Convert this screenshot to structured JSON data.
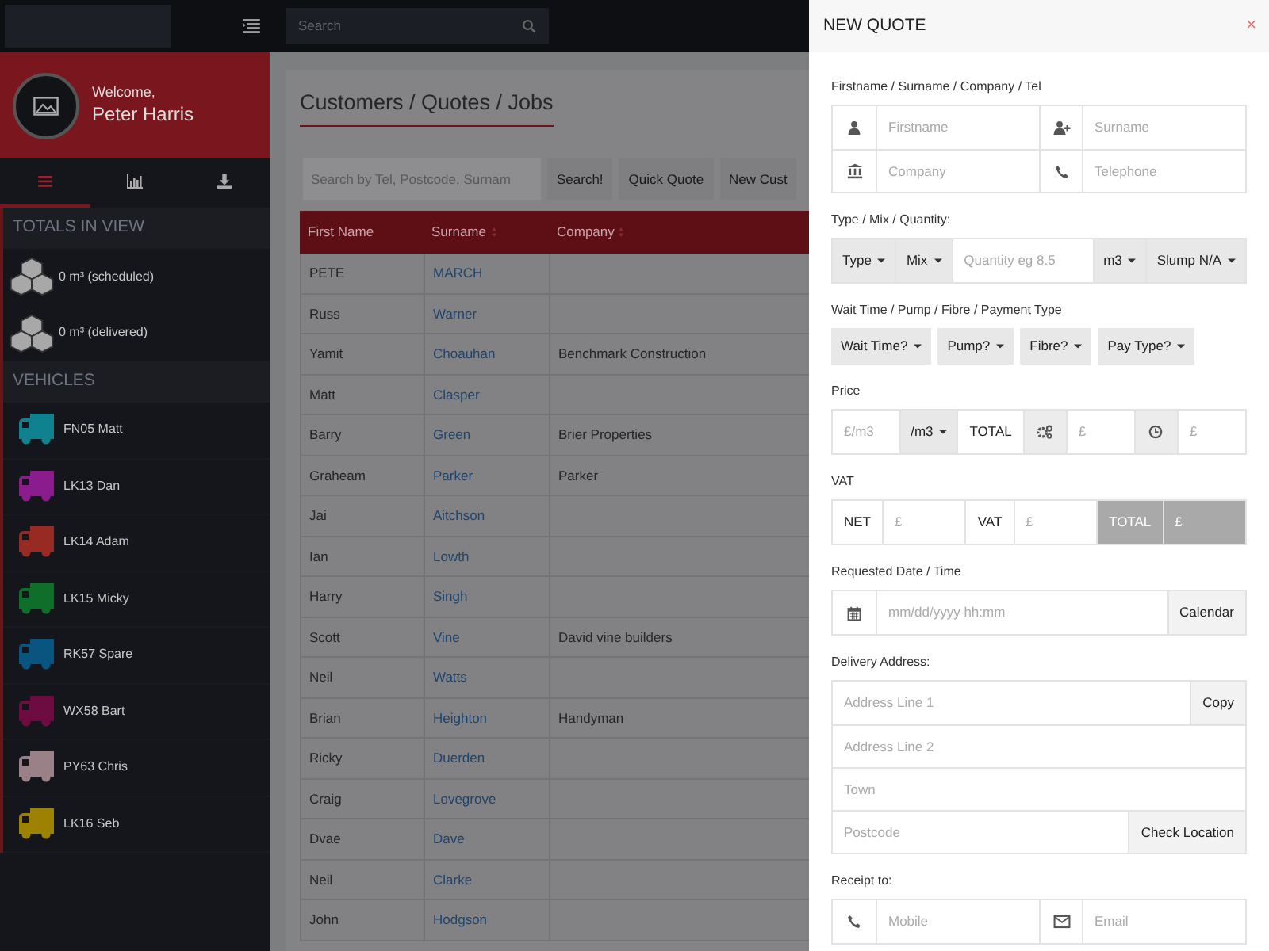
{
  "topbar": {
    "search": {
      "placeholder": "Search"
    }
  },
  "sidebar": {
    "welcome": "Welcome,",
    "user": "Peter Harris",
    "tabs": [
      {
        "selected": true
      },
      {
        "selected": false
      },
      {
        "selected": false
      }
    ],
    "totals_title": "TOTALS IN VIEW",
    "totals": [
      "0 m³ (scheduled)",
      "0 m³ (delivered)"
    ],
    "vehicles_title": "VEHICLES",
    "vehicles": [
      {
        "label": "FN05 Matt",
        "color": "#10828f"
      },
      {
        "label": "LK13 Dan",
        "color": "#8a1c8e"
      },
      {
        "label": "LK14 Adam",
        "color": "#972a22"
      },
      {
        "label": "LK15 Micky",
        "color": "#0f6e2a"
      },
      {
        "label": "RK57 Spare",
        "color": "#0a5580"
      },
      {
        "label": "WX58 Bart",
        "color": "#6c0c41"
      },
      {
        "label": "PY63 Chris",
        "color": "#9a8087"
      },
      {
        "label": "LK16 Seb",
        "color": "#9c8200"
      }
    ]
  },
  "main": {
    "title": "Customers / Quotes / Jobs",
    "search": {
      "placeholder": "Search by Tel, Postcode, Surnam"
    },
    "buttons": [
      "Search!",
      "Quick Quote",
      "New Cust"
    ],
    "table": {
      "columns": [
        "First Name",
        "Surname",
        "Company"
      ],
      "rows": [
        [
          "PETE",
          "MARCH",
          ""
        ],
        [
          "Russ",
          "Warner",
          ""
        ],
        [
          "Yamit",
          "Choauhan",
          "Benchmark Construction"
        ],
        [
          "Matt",
          "Clasper",
          ""
        ],
        [
          "Barry",
          "Green",
          "Brier Properties"
        ],
        [
          "Graheam",
          "Parker",
          "Parker"
        ],
        [
          "Jai",
          "Aitchson",
          ""
        ],
        [
          "Ian",
          "Lowth",
          ""
        ],
        [
          "Harry",
          "Singh",
          ""
        ],
        [
          "Scott",
          "Vine",
          "David vine builders"
        ],
        [
          "Neil",
          "Watts",
          ""
        ],
        [
          "Brian",
          "Heighton",
          "Handyman"
        ],
        [
          "Ricky",
          "Duerden",
          ""
        ],
        [
          "Craig",
          "Lovegrove",
          ""
        ],
        [
          "Dvae",
          "Dave",
          ""
        ],
        [
          "Neil",
          "Clarke",
          ""
        ],
        [
          "John",
          "Hodgson",
          ""
        ]
      ]
    }
  },
  "drawer": {
    "title": "NEW QUOTE",
    "close": "×",
    "sections": [
      {
        "label": "Firstname / Surname / Company / Tel",
        "kind": "input-group",
        "rows": [
          [
            {
              "kind": "icon"
            },
            {
              "kind": "input",
              "placeholder": "Firstname"
            },
            {
              "kind": "icon"
            },
            {
              "kind": "input",
              "placeholder": "Surname"
            }
          ],
          [
            {
              "kind": "icon"
            },
            {
              "kind": "input",
              "placeholder": "Company"
            },
            {
              "kind": "icon"
            },
            {
              "kind": "input",
              "placeholder": "Telephone"
            }
          ]
        ]
      },
      {
        "label": "Type / Mix / Quantity:",
        "kind": "input-group",
        "rows": [
          [
            {
              "kind": "dropdown",
              "label": "Type"
            },
            {
              "kind": "dropdown",
              "label": "Mix"
            },
            {
              "kind": "input",
              "placeholder": "Quantity eg 8.5"
            },
            {
              "kind": "dropdown",
              "label": "m3"
            },
            {
              "kind": "dropdown",
              "label": "Slump N/A"
            }
          ]
        ]
      },
      {
        "label": "Wait Time / Pump / Fibre / Payment Type",
        "kind": "button-row",
        "rows": [
          [
            {
              "kind": "dropdown",
              "label": "Wait Time?"
            },
            {
              "kind": "dropdown",
              "label": "Pump?"
            },
            {
              "kind": "dropdown",
              "label": "Fibre?"
            },
            {
              "kind": "dropdown",
              "label": "Pay Type?"
            }
          ]
        ]
      },
      {
        "label": "Price",
        "kind": "input-group",
        "rows": [
          [
            {
              "kind": "input",
              "placeholder": "£/m3"
            },
            {
              "kind": "dropdown",
              "label": "/m3"
            },
            {
              "kind": "addon",
              "label": "TOTAL"
            },
            {
              "kind": "shaded-icon"
            },
            {
              "kind": "input",
              "placeholder": "£"
            },
            {
              "kind": "shaded-icon"
            },
            {
              "kind": "input",
              "placeholder": "£"
            }
          ]
        ]
      },
      {
        "label": "VAT",
        "kind": "input-group",
        "rows": [
          [
            {
              "kind": "addon",
              "label": "NET",
              "disabled": false
            },
            {
              "kind": "input",
              "placeholder": "£",
              "disabled": false
            },
            {
              "kind": "addon",
              "label": "VAT",
              "disabled": false
            },
            {
              "kind": "input",
              "placeholder": "£",
              "disabled": false
            },
            {
              "kind": "addon",
              "label": "TOTAL",
              "disabled": true
            },
            {
              "kind": "input",
              "placeholder": "£",
              "disabled": true
            }
          ]
        ]
      },
      {
        "label": "Requested Date / Time",
        "kind": "input-group",
        "rows": [
          [
            {
              "kind": "icon"
            },
            {
              "kind": "input",
              "placeholder": "mm/dd/yyyy hh:mm"
            },
            {
              "kind": "button",
              "label": "Calendar"
            }
          ]
        ]
      },
      {
        "label": "Delivery Address:",
        "kind": "input-group",
        "rows": [
          [
            {
              "kind": "input",
              "placeholder": "Address Line 1"
            },
            {
              "kind": "button",
              "label": "Copy"
            }
          ],
          [
            {
              "kind": "input",
              "placeholder": "Address Line 2"
            }
          ],
          [
            {
              "kind": "input",
              "placeholder": "Town"
            }
          ],
          [
            {
              "kind": "input",
              "placeholder": "Postcode"
            },
            {
              "kind": "button",
              "label": "Check Location"
            }
          ]
        ]
      },
      {
        "label": "Receipt to:",
        "kind": "input-group",
        "rows": [
          [
            {
              "kind": "icon"
            },
            {
              "kind": "input",
              "placeholder": "Mobile"
            },
            {
              "kind": "icon"
            },
            {
              "kind": "input",
              "placeholder": "Email"
            }
          ]
        ]
      }
    ]
  }
}
